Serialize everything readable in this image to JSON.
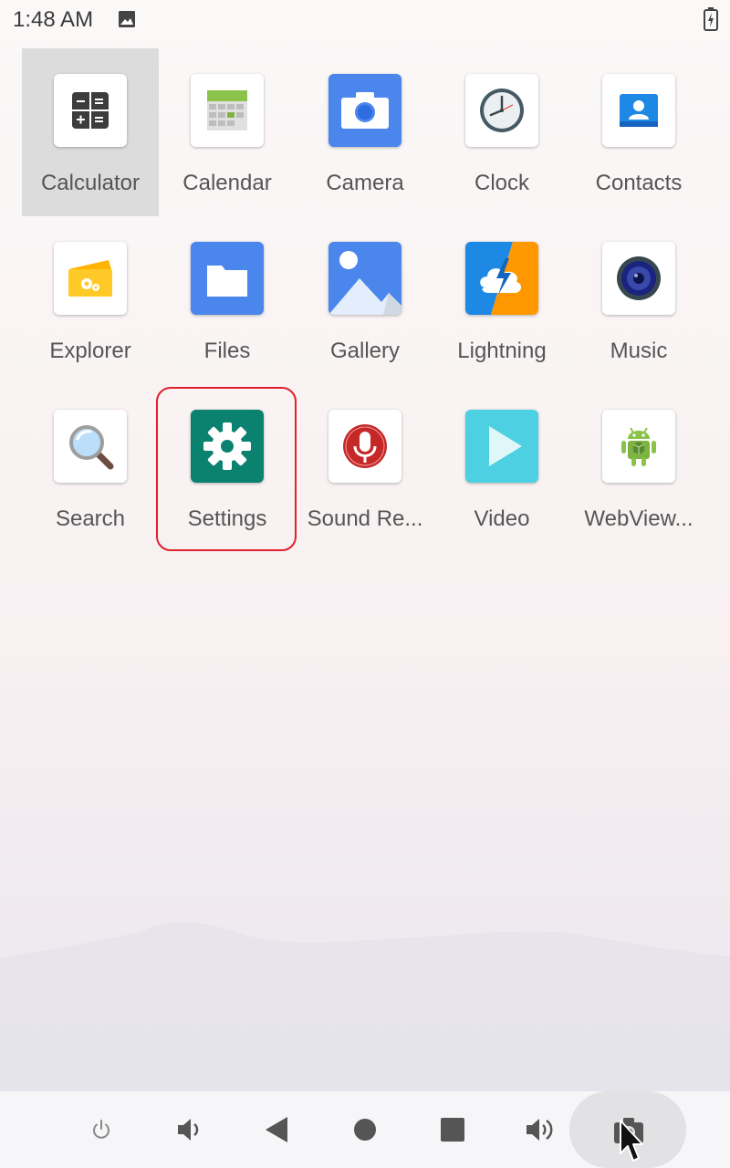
{
  "status_bar": {
    "time": "1:48 AM",
    "icons": [
      "image-notification-icon",
      "battery-charging-icon"
    ]
  },
  "apps": [
    {
      "label": "Calculator",
      "icon": "calculator-icon",
      "selected": true
    },
    {
      "label": "Calendar",
      "icon": "calendar-icon"
    },
    {
      "label": "Camera",
      "icon": "camera-icon"
    },
    {
      "label": "Clock",
      "icon": "clock-icon"
    },
    {
      "label": "Contacts",
      "icon": "contacts-icon"
    },
    {
      "label": "Explorer",
      "icon": "explorer-icon"
    },
    {
      "label": "Files",
      "icon": "folder-icon"
    },
    {
      "label": "Gallery",
      "icon": "gallery-icon"
    },
    {
      "label": "Lightning",
      "icon": "lightning-icon"
    },
    {
      "label": "Music",
      "icon": "speaker-icon"
    },
    {
      "label": "Search",
      "icon": "magnifier-icon"
    },
    {
      "label": "Settings",
      "icon": "gear-icon",
      "highlighted": true
    },
    {
      "label": "Sound Re...",
      "icon": "microphone-icon"
    },
    {
      "label": "Video",
      "icon": "play-icon"
    },
    {
      "label": "WebView...",
      "icon": "android-icon"
    }
  ],
  "nav_bar": {
    "buttons": [
      "power-icon",
      "volume-down-icon",
      "back-icon",
      "home-icon",
      "recents-icon",
      "volume-up-icon",
      "screenshot-icon"
    ]
  },
  "colors": {
    "camera_bg": "#4a86ec",
    "files_bg": "#4a86ec",
    "settings_bg": "#0b8170",
    "video_bg": "#4dd0e1",
    "highlight": "#e0202a"
  }
}
